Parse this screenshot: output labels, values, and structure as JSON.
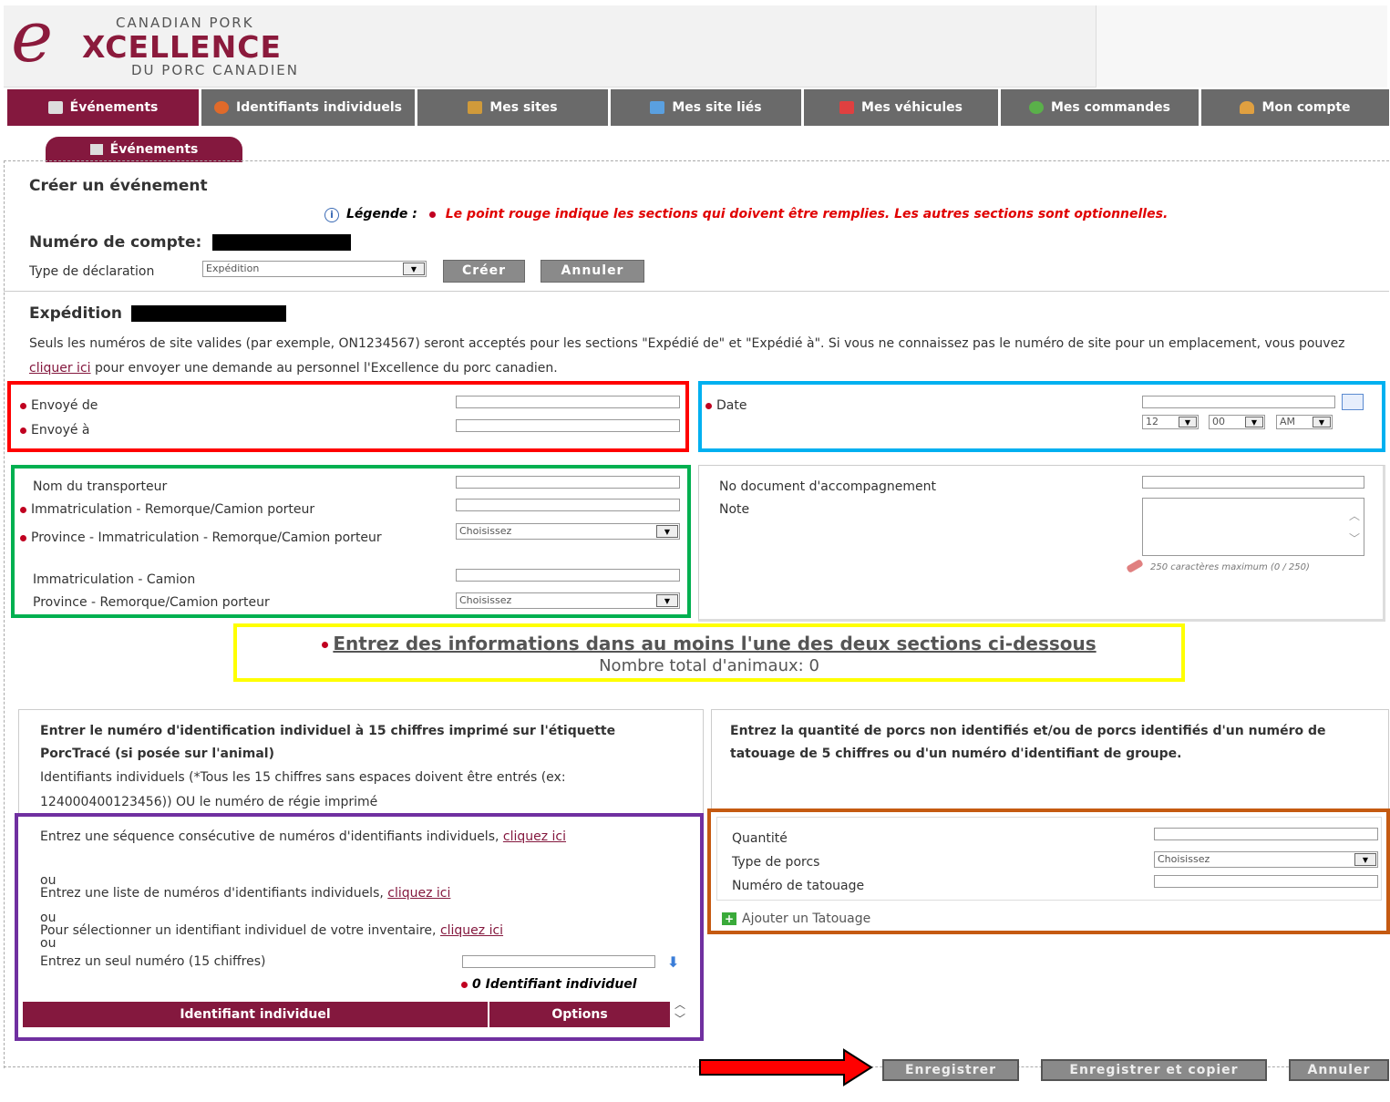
{
  "logo": {
    "line1": "CANADIAN PORK",
    "big_letter": "e",
    "line2": "XCELLENCE",
    "line3": "DU PORC CANADIEN"
  },
  "nav": {
    "tabs": [
      {
        "label": "Événements",
        "icon": "calendar-icon",
        "color": "#dddddd"
      },
      {
        "label": "Identifiants individuels",
        "icon": "pig-tag-icon",
        "color": "#e06a2a"
      },
      {
        "label": "Mes sites",
        "icon": "barn-icon",
        "color": "#d09a3a"
      },
      {
        "label": "Mes site liés",
        "icon": "linked-sites-icon",
        "color": "#5aa0e0"
      },
      {
        "label": "Mes véhicules",
        "icon": "truck-icon",
        "color": "#e04040"
      },
      {
        "label": "Mes commandes",
        "icon": "orders-icon",
        "color": "#5ab04a"
      },
      {
        "label": "Mon compte",
        "icon": "user-icon",
        "color": "#e0a040"
      }
    ]
  },
  "subtab": {
    "label": "Événements",
    "icon": "calendar-icon"
  },
  "page": {
    "title": "Créer un événement",
    "legend_label": "Légende :",
    "legend_text": "Le point rouge indique les sections qui doivent être remplies. Les autres sections sont optionnelles.",
    "account_label": "Numéro de compte:",
    "declaration_label": "Type de déclaration",
    "declaration_value": "Expédition",
    "create_btn": "Créer",
    "cancel_btn": "Annuler"
  },
  "expedition": {
    "title": "Expédition",
    "desc_part1": "Seuls les numéros de site valides (par exemple, ON1234567) seront acceptés pour les sections \"Expédié de\" et \"Expédié à\". Si vous ne connaissez pas le numéro de site pour un emplacement, vous pouvez ",
    "desc_link": "cliquer ici",
    "desc_part2": " pour envoyer une demande au personnel l'Excellence du porc canadien."
  },
  "origin": {
    "from_label": "Envoyé de",
    "to_label": "Envoyé à"
  },
  "datebox": {
    "date_label": "Date",
    "hour": "12",
    "minute": "00",
    "ampm": "AM"
  },
  "transport": {
    "carrier_label": "Nom du transporteur",
    "plate_label": "Immatriculation - Remorque/Camion porteur",
    "province_label": "Province - Immatriculation - Remorque/Camion porteur",
    "truck_plate_label": "Immatriculation - Camion",
    "truck_province_label": "Province - Remorque/Camion porteur",
    "choose": "Choisissez"
  },
  "docs": {
    "doc_label": "No document d'accompagnement",
    "note_label": "Note",
    "char_limit": "250 caractères maximum (0 / 250)"
  },
  "banner": {
    "line1": "Entrez des informations dans au moins l'une des deux sections ci-dessous",
    "line2": "Nombre total d'animaux: 0"
  },
  "left_section": {
    "heading": "Entrer le numéro d'identification individuel à 15 chiffres imprimé sur l'étiquette PorcTracé (si posée sur l'animal)",
    "subtext": "Identifiants individuels (*Tous les 15 chiffres sans espaces doivent être entrés (ex: 124000400123456)) OU le numéro de régie imprimé",
    "seq_text": "Entrez une séquence consécutive de numéros d'identifiants individuels, ",
    "seq_link": "cliquez ici",
    "or": "ou",
    "list_text": "Entrez une liste de numéros d'identifiants individuels, ",
    "list_link": "cliquez ici",
    "inv_text": "Pour sélectionner un identifiant individuel de votre inventaire, ",
    "inv_link": "cliquez ici",
    "single_text": "Entrez un seul numéro (15 chiffres)",
    "count_text": "0 Identifiant individuel",
    "col1": "Identifiant individuel",
    "col2": "Options"
  },
  "right_section": {
    "heading": "Entrez la quantité de porcs non identifiés et/ou de porcs identifiés d'un numéro de tatouage de 5 chiffres ou d'un numéro d'identifiant de groupe.",
    "qty_label": "Quantité",
    "type_label": "Type de porcs",
    "tattoo_label": "Numéro de tatouage",
    "choose": "Choisissez",
    "add_tattoo": "Ajouter un Tatouage"
  },
  "footer": {
    "save": "Enregistrer",
    "save_copy": "Enregistrer et copier",
    "cancel": "Annuler"
  },
  "colors": {
    "brand": "#84183e",
    "box_red": "#ff0000",
    "box_blue": "#00b0f0",
    "box_green": "#00b050",
    "box_yellow": "#ffff00",
    "box_purple": "#7030a0",
    "box_orange": "#c55a11"
  }
}
